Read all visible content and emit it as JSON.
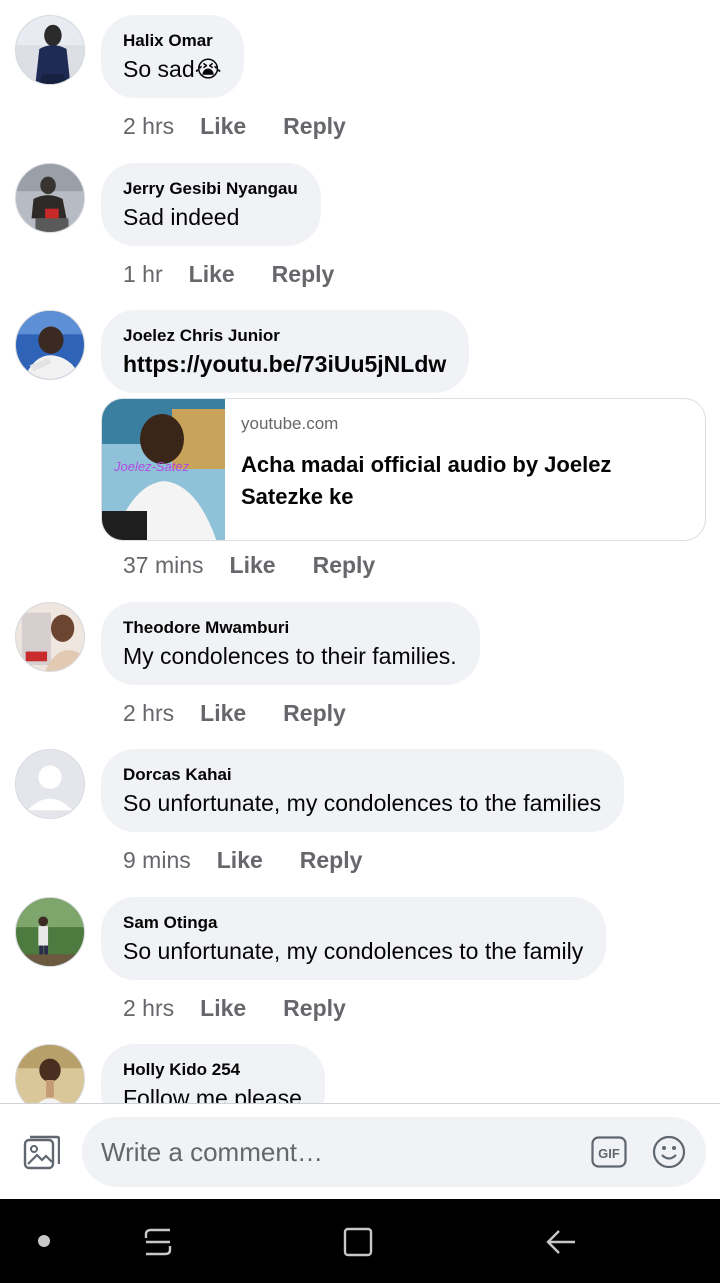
{
  "comments": [
    {
      "author": "Halix Omar",
      "text": "So sad😭",
      "time": "2 hrs",
      "like": "Like",
      "reply": "Reply"
    },
    {
      "author": "Jerry Gesibi Nyangau",
      "text": "Sad indeed",
      "time": "1 hr",
      "like": "Like",
      "reply": "Reply"
    },
    {
      "author": "Joelez Chris Junior",
      "text": "https://youtu.be/73iUu5jNLdw",
      "time": "37 mins",
      "like": "Like",
      "reply": "Reply",
      "link": {
        "domain": "youtube.com",
        "title": "Acha madai official audio by Joelez Satezke ke",
        "thumb_label": "Joelez-Satez"
      }
    },
    {
      "author": "Theodore Mwamburi",
      "text": "My condolences to their families.",
      "time": "2 hrs",
      "like": "Like",
      "reply": "Reply"
    },
    {
      "author": "Dorcas Kahai",
      "text": "So unfortunate, my condolences to the families",
      "time": "9 mins",
      "like": "Like",
      "reply": "Reply"
    },
    {
      "author": "Sam Otinga",
      "text": "So unfortunate, my condolences to the family",
      "time": "2 hrs",
      "like": "Like",
      "reply": "Reply"
    },
    {
      "author": "Holly Kido 254",
      "text": "Follow me please"
    }
  ],
  "composer": {
    "placeholder": "Write a comment…",
    "photo_icon": "photo-icon",
    "gif_icon": "gif-icon",
    "gif_label": "GIF",
    "emoji_icon": "emoji-icon"
  },
  "navbar": {
    "icons": [
      "dot-icon",
      "recent-apps-icon",
      "home-icon",
      "back-icon"
    ]
  },
  "colors": {
    "bubble": "#f0f2f5",
    "secondary_text": "#65676b",
    "navbar": "#000000"
  }
}
